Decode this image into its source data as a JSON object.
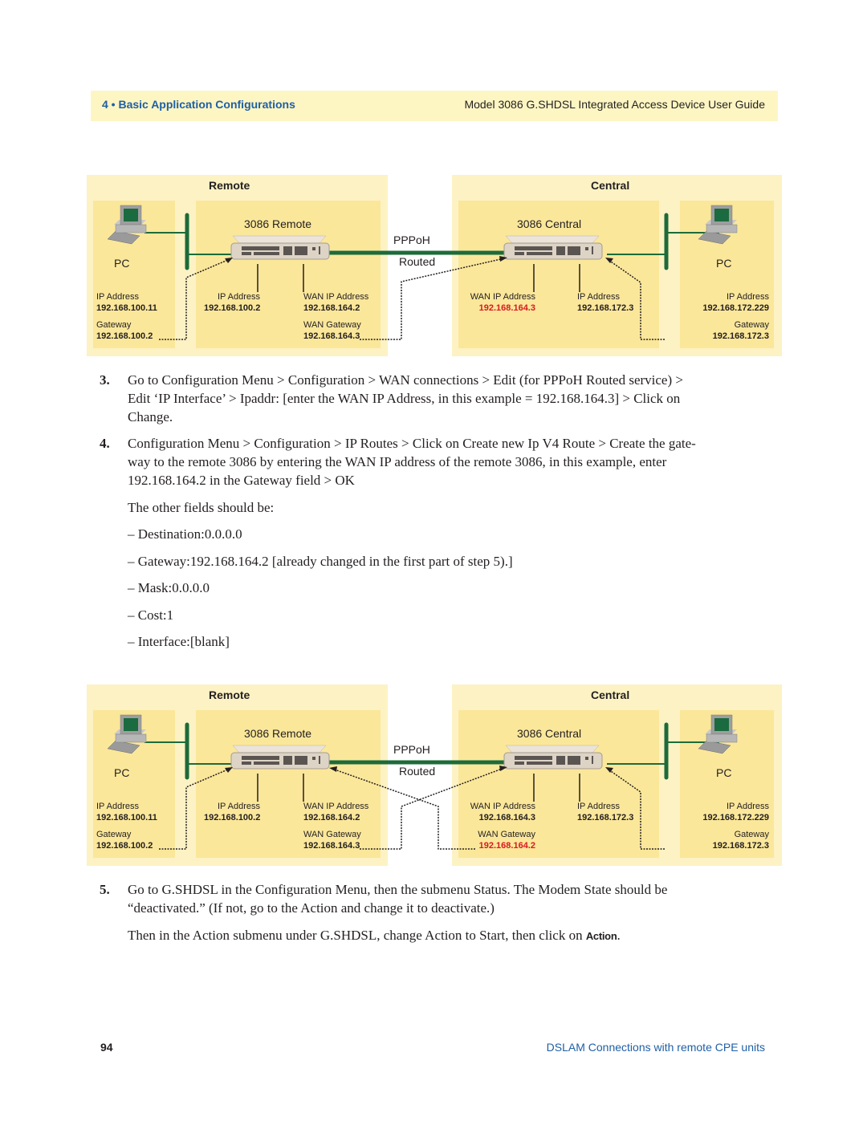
{
  "header": {
    "section": "4 • Basic Application Configurations",
    "guide_title": "Model 3086 G.SHDSL Integrated Access Device User Guide"
  },
  "diagrams": [
    {
      "remote": {
        "title": "Remote",
        "device_name": "3086 Remote",
        "pc_label": "PC",
        "pc_ip_label": "IP Address",
        "pc_ip": "192.168.100.11",
        "pc_gw_label": "Gateway",
        "pc_gw": "192.168.100.2",
        "dev_ip_label": "IP Address",
        "dev_ip": "192.168.100.2",
        "wan_ip_label": "WAN IP Address",
        "wan_ip": "192.168.164.2",
        "wan_gw_label": "WAN Gateway",
        "wan_gw": "192.168.164.3"
      },
      "link": {
        "line1": "PPPoH",
        "line2": "Routed"
      },
      "central": {
        "title": "Central",
        "device_name": "3086 Central",
        "pc_label": "PC",
        "wan_ip_label": "WAN IP Address",
        "wan_ip": "192.168.164.3",
        "wan_ip_highlight": true,
        "dev_ip_label": "IP Address",
        "dev_ip": "192.168.172.3",
        "pc_ip_label": "IP Address",
        "pc_ip": "192.168.172.229",
        "pc_gw_label": "Gateway",
        "pc_gw": "192.168.172.3"
      }
    },
    {
      "remote": {
        "title": "Remote",
        "device_name": "3086 Remote",
        "pc_label": "PC",
        "pc_ip_label": "IP Address",
        "pc_ip": "192.168.100.11",
        "pc_gw_label": "Gateway",
        "pc_gw": "192.168.100.2",
        "dev_ip_label": "IP Address",
        "dev_ip": "192.168.100.2",
        "wan_ip_label": "WAN IP Address",
        "wan_ip": "192.168.164.2",
        "wan_gw_label": "WAN Gateway",
        "wan_gw": "192.168.164.3"
      },
      "link": {
        "line1": "PPPoH",
        "line2": "Routed"
      },
      "central": {
        "title": "Central",
        "device_name": "3086 Central",
        "pc_label": "PC",
        "wan_ip_label": "WAN IP Address",
        "wan_ip": "192.168.164.3",
        "wan_gw_label": "WAN Gateway",
        "wan_gw": "192.168.164.2",
        "wan_gw_highlight": true,
        "dev_ip_label": "IP Address",
        "dev_ip": "192.168.172.3",
        "pc_ip_label": "IP Address",
        "pc_ip": "192.168.172.229",
        "pc_gw_label": "Gateway",
        "pc_gw": "192.168.172.3"
      }
    }
  ],
  "steps": {
    "s3": {
      "num": "3.",
      "line1": "Go to Configuration Menu > Configuration > WAN connections > Edit (for PPPoH Routed service) >",
      "line2": "Edit ‘IP Interface’ > Ipaddr: [enter the WAN IP Address, in this example = 192.168.164.3] > Click on",
      "line3": "Change."
    },
    "s4": {
      "num": "4.",
      "line1": "Configuration Menu > Configuration > IP Routes > Click on Create new Ip V4 Route  > Create the gate-",
      "line2": "way to the remote 3086 by entering the WAN IP address of the remote 3086, in this example, enter",
      "line3": "192.168.164.2 in the Gateway field > OK"
    },
    "other_fields_intro": "The other fields should be:",
    "fields": [
      "– Destination:0.0.0.0",
      "– Gateway:192.168.164.2   [already changed in the first part of step 5).]",
      "– Mask:0.0.0.0",
      "– Cost:1",
      "– Interface:[blank]"
    ],
    "s5": {
      "num": "5.",
      "line1": "Go to G.SHDSL in the Configuration Menu, then the submenu Status.  The Modem State should be",
      "line2": "“deactivated.” (If not, go to the Action and change it to deactivate.)"
    },
    "then_text": "Then in the Action submenu under G.SHDSL, change Action to Start, then click on ",
    "then_keyword": "Action",
    "then_end": "."
  },
  "footer": {
    "page_number": "94",
    "section_title": "DSLAM Connections with remote CPE units"
  },
  "colors": {
    "header_bg": "#fdf6c3",
    "accent_blue": "#1f5fa6",
    "panel_outer": "#fdf2c4",
    "panel_inner": "#fbe79a",
    "link_green": "#1d6b3a",
    "highlight_red": "#d7191f"
  }
}
